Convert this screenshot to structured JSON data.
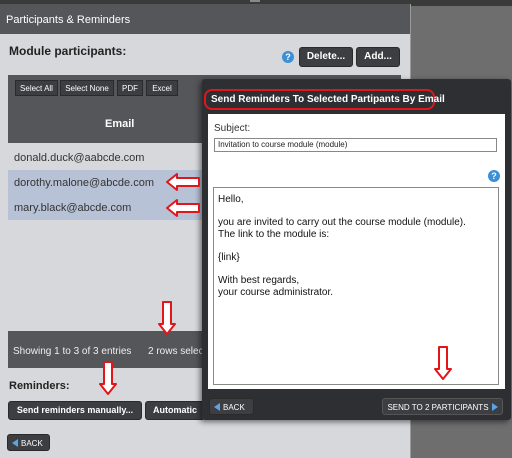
{
  "panel": {
    "title": "Participants & Reminders",
    "section_title": "Module participants:",
    "help": "?",
    "delete_label": "Delete...",
    "add_label": "Add...",
    "toolbar": {
      "select_all": "Select All",
      "select_none": "Select None",
      "pdf": "PDF",
      "excel": "Excel"
    },
    "column_email": "Email",
    "rows": [
      {
        "email": "donald.duck@aabcde.com",
        "selected": false
      },
      {
        "email": "dorothy.malone@abcde.com",
        "selected": true
      },
      {
        "email": "mary.black@abcde.com",
        "selected": true
      }
    ],
    "footer_entries": "Showing 1 to 3 of 3 entries",
    "footer_selected": "2 rows selec",
    "reminders_label": "Reminders:",
    "send_manually_label": "Send reminders manually...",
    "automatic_label": "Automatic",
    "back_label": "BACK"
  },
  "dialog": {
    "title": "Send Reminders To Selected Partipants By Email",
    "subject_label": "Subject:",
    "subject_value": "Invitation to course module (module)",
    "help": "?",
    "body_lines": [
      "Hello,",
      "you are invited to carry out the course module (module).",
      "The link to the module is:",
      "{link}",
      "With best regards,",
      "your course administrator."
    ],
    "back_label": "BACK",
    "send_label": "SEND TO 2 PARTICIPANTS"
  },
  "colors": {
    "accent_blue": "#3d8fd6",
    "annotation_red": "#e0161b",
    "selected_row": "#b8c2d6"
  }
}
